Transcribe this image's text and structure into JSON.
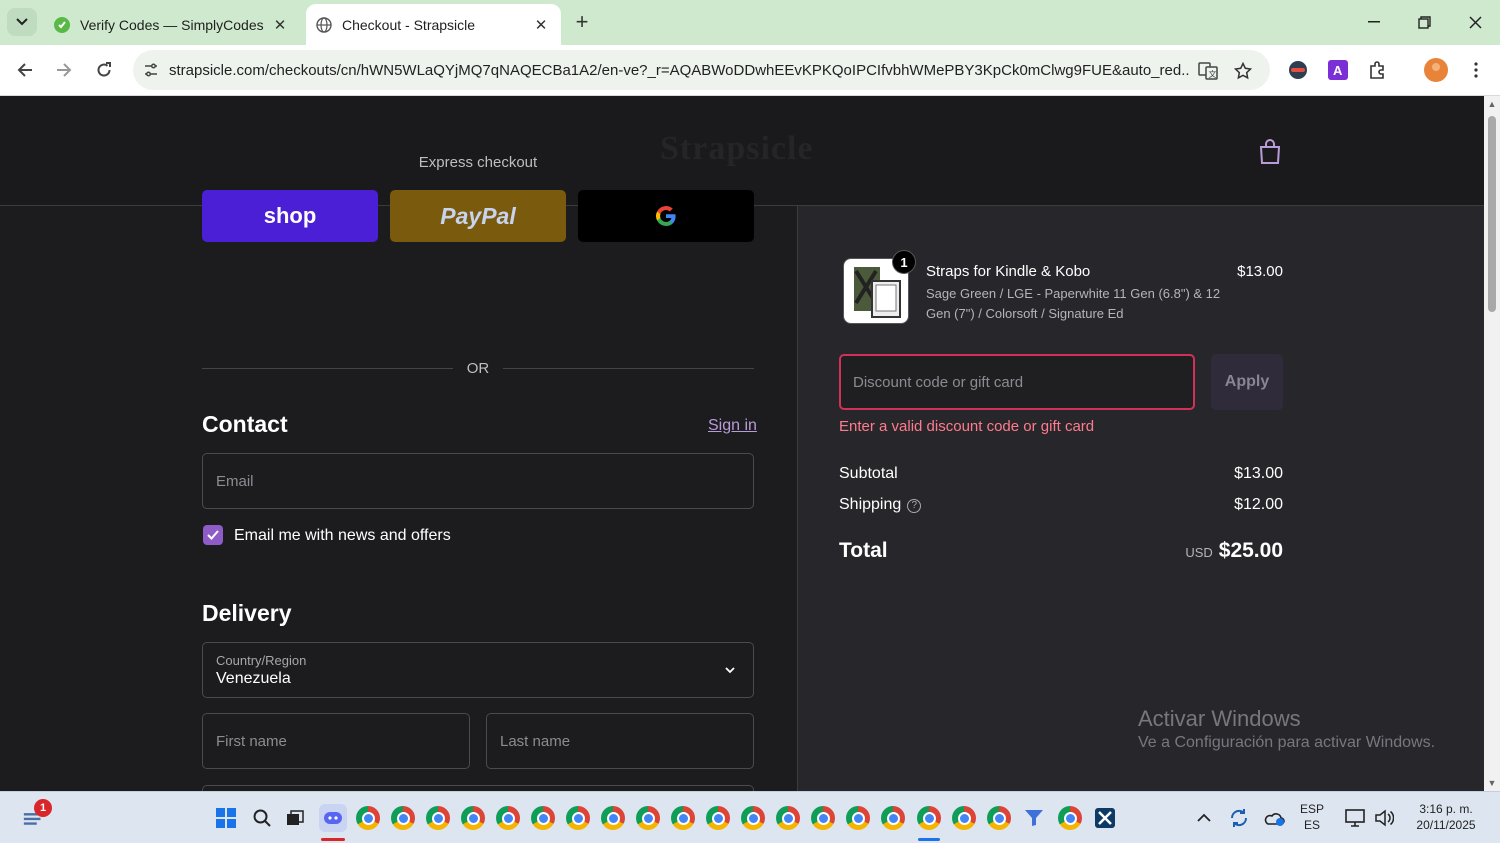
{
  "browser": {
    "tabs": [
      {
        "title": "Verify Codes — SimplyCodes",
        "icon": "simplycodes-icon",
        "active": false
      },
      {
        "title": "Checkout - Strapsicle",
        "icon": "globe-icon",
        "active": true
      }
    ],
    "url": "strapsicle.com/checkouts/cn/hWN5WLaQYjMQ7qNAQECBa1A2/en-ve?_r=AQABWoDDwhEEvKPKQoIPCIfvbhWMePBY3KpCk0mClwg9FUE&auto_red..."
  },
  "header": {
    "logo_text": "Strapsicle"
  },
  "express": {
    "label": "Express checkout",
    "shop_label": "shop",
    "paypal_label": "PayPal",
    "or_label": "OR"
  },
  "contact": {
    "title": "Contact",
    "sign_in": "Sign in",
    "email_placeholder": "Email",
    "newsletter_label": "Email me with news and offers",
    "newsletter_checked": true
  },
  "delivery": {
    "title": "Delivery",
    "country_label": "Country/Region",
    "country_value": "Venezuela",
    "first_name_placeholder": "First name",
    "last_name_placeholder": "Last name"
  },
  "summary": {
    "item": {
      "quantity": "1",
      "name": "Straps for Kindle & Kobo",
      "variant": "Sage Green / LGE - Paperwhite 11 Gen (6.8\") & 12 Gen (7\") / Colorsoft / Signature Ed",
      "price": "$13.00"
    },
    "discount_placeholder": "Discount code or gift card",
    "apply_label": "Apply",
    "discount_error": "Enter a valid discount code or gift card",
    "subtotal_label": "Subtotal",
    "subtotal_value": "$13.00",
    "shipping_label": "Shipping",
    "shipping_value": "$12.00",
    "total_label": "Total",
    "total_currency": "USD",
    "total_value": "$25.00"
  },
  "watermark": {
    "line1": "Activar Windows",
    "line2": "Ve a Configuración para activar Windows."
  },
  "taskbar": {
    "notification_count": "1",
    "lang_line1": "ESP",
    "lang_line2": "ES",
    "time": "3:16 p. m.",
    "date": "20/11/2025"
  },
  "colors": {
    "accent_purple": "#8e5bc7",
    "error_red": "#ff7b8d",
    "shop_pay": "#4b1fd6",
    "paypal": "#7a5a0c"
  }
}
